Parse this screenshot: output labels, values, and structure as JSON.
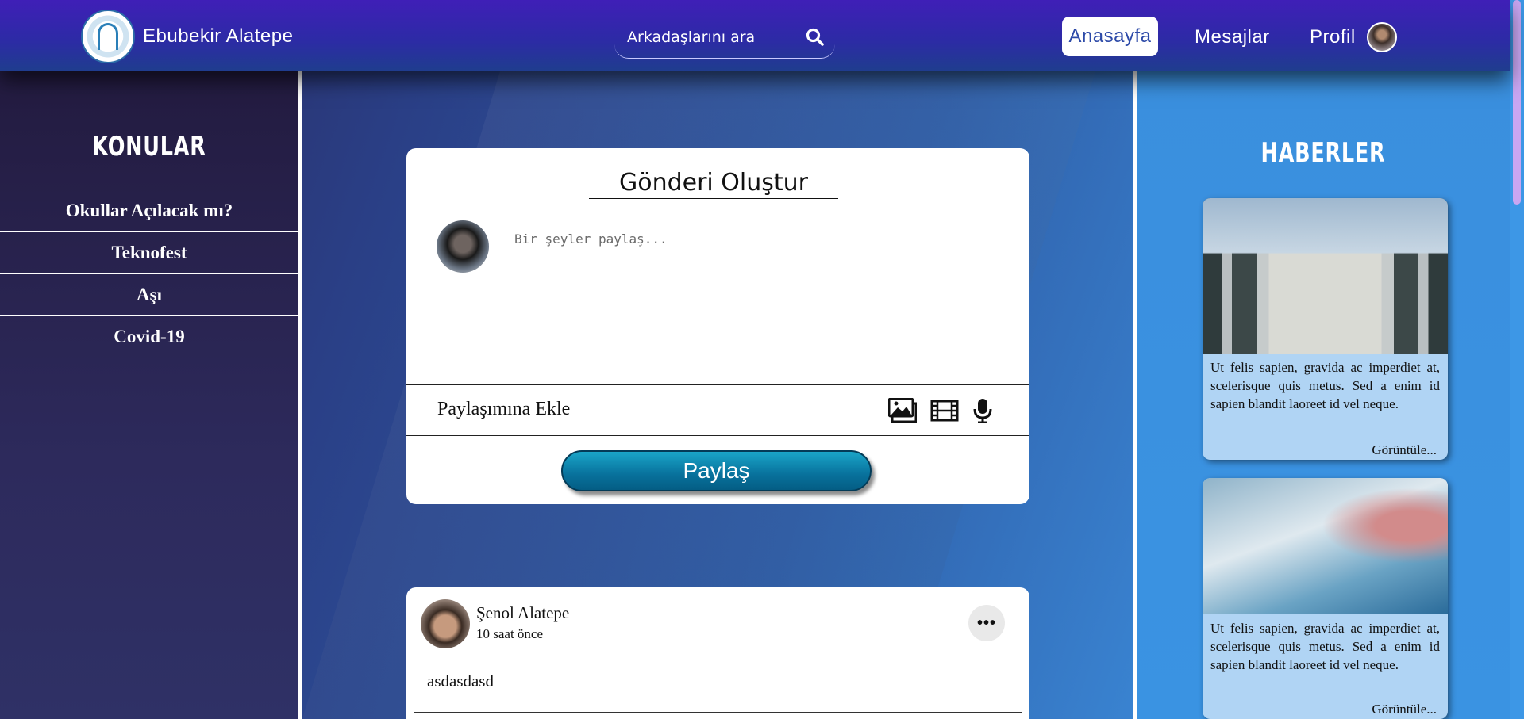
{
  "header": {
    "brand_name": "Ebubekir Alatepe",
    "logo_icon": "university-logo-icon",
    "search": {
      "placeholder": "Arkadaşlarını ara",
      "value": "",
      "icon": "search-icon"
    },
    "nav": {
      "home": "Anasayfa",
      "messages": "Mesajlar",
      "profile": "Profil"
    },
    "accent_color": "#3f1fb7"
  },
  "left_sidebar": {
    "title": "KONULAR",
    "topics": [
      "Okullar Açılacak mı?",
      "Teknofest",
      "Aşı",
      "Covid-19"
    ]
  },
  "create_post": {
    "title": "Gönderi Oluştur",
    "placeholder": "Bir şeyler paylaş...",
    "add_label": "Paylaşımına Ekle",
    "media_icons": [
      "image-icon",
      "film-icon",
      "microphone-icon"
    ],
    "share_button": "Paylaş"
  },
  "post": {
    "author": "Şenol Alatepe",
    "time": "10 saat önce",
    "body": "asdasdasd",
    "more_icon": "more-options-icon"
  },
  "news": {
    "title": "HABERLER",
    "items": [
      {
        "image": "university-building-image",
        "text": "Ut felis sapien, gravida ac imperdiet at, scelerisque quis metus. Sed a enim id sapien blandit laoreet id vel neque.",
        "link": "Görüntüle..."
      },
      {
        "image": "vaccine-syringe-image",
        "text": "Ut felis sapien, gravida ac imperdiet at, scelerisque quis metus. Sed a enim id sapien blandit laoreet id vel neque.",
        "link": "Görüntüle..."
      }
    ]
  }
}
